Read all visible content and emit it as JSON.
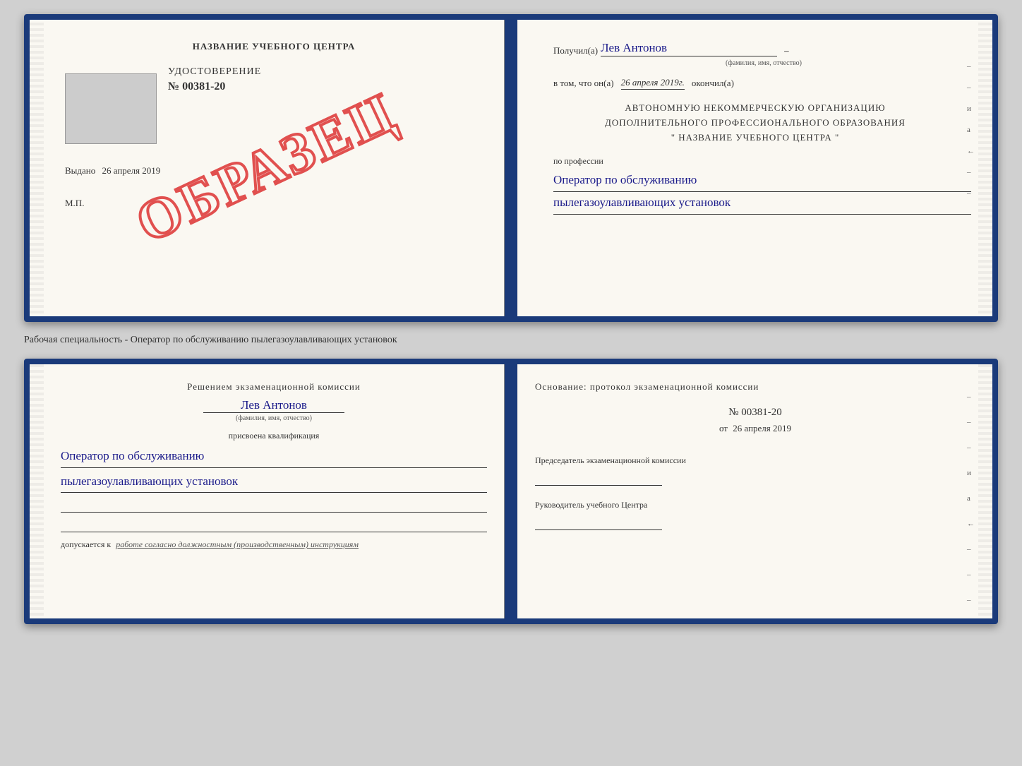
{
  "top_cert": {
    "left": {
      "title": "НАЗВАНИЕ УЧЕБНОГО ЦЕНТРА",
      "cert_label": "УДОСТОВЕРЕНИЕ",
      "cert_number": "№ 00381-20",
      "issued_label": "Выдано",
      "issued_date": "26 апреля 2019",
      "mp_label": "М.П.",
      "watermark": "ОБРАЗЕЦ"
    },
    "right": {
      "received_label": "Получил(а)",
      "recipient_name": "Лев Антонов",
      "name_subtitle": "(фамилия, имя, отчество)",
      "date_prefix": "в том, что он(а)",
      "date_value": "26 апреля 2019г.",
      "date_suffix": "окончил(а)",
      "org_line1": "АВТОНОМНУЮ НЕКОММЕРЧЕСКУЮ ОРГАНИЗАЦИЮ",
      "org_line2": "ДОПОЛНИТЕЛЬНОГО ПРОФЕССИОНАЛЬНОГО ОБРАЗОВАНИЯ",
      "org_line3": "\"  НАЗВАНИЕ УЧЕБНОГО ЦЕНТРА  \"",
      "profession_label": "по профессии",
      "profession_line1": "Оператор по обслуживанию",
      "profession_line2": "пылегазоулавливающих установок",
      "edge_marks": [
        "–",
        "–",
        "и",
        "а",
        "←",
        "–",
        "–",
        "–"
      ]
    }
  },
  "separator": {
    "text": "Рабочая специальность - Оператор по обслуживанию пылегазоулавливающих установок"
  },
  "bottom_cert": {
    "left": {
      "decision_header": "Решением экзаменационной комиссии",
      "name": "Лев Антонов",
      "name_subtitle": "(фамилия, имя, отчество)",
      "assigned_label": "присвоена квалификация",
      "qual_line1": "Оператор по обслуживанию",
      "qual_line2": "пылегазоулавливающих установок",
      "допускается_label": "допускается к",
      "допускается_value": "работе согласно должностным (производственным) инструкциям"
    },
    "right": {
      "osnov_label": "Основание: протокол экзаменационной комиссии",
      "protocol_number": "№ 00381-20",
      "protocol_date_prefix": "от",
      "protocol_date": "26 апреля 2019",
      "chairman_label": "Председатель экзаменационной комиссии",
      "rukov_label": "Руководитель учебного Центра",
      "edge_marks": [
        "–",
        "–",
        "–",
        "и",
        "а",
        "←",
        "–",
        "–",
        "–"
      ]
    }
  }
}
